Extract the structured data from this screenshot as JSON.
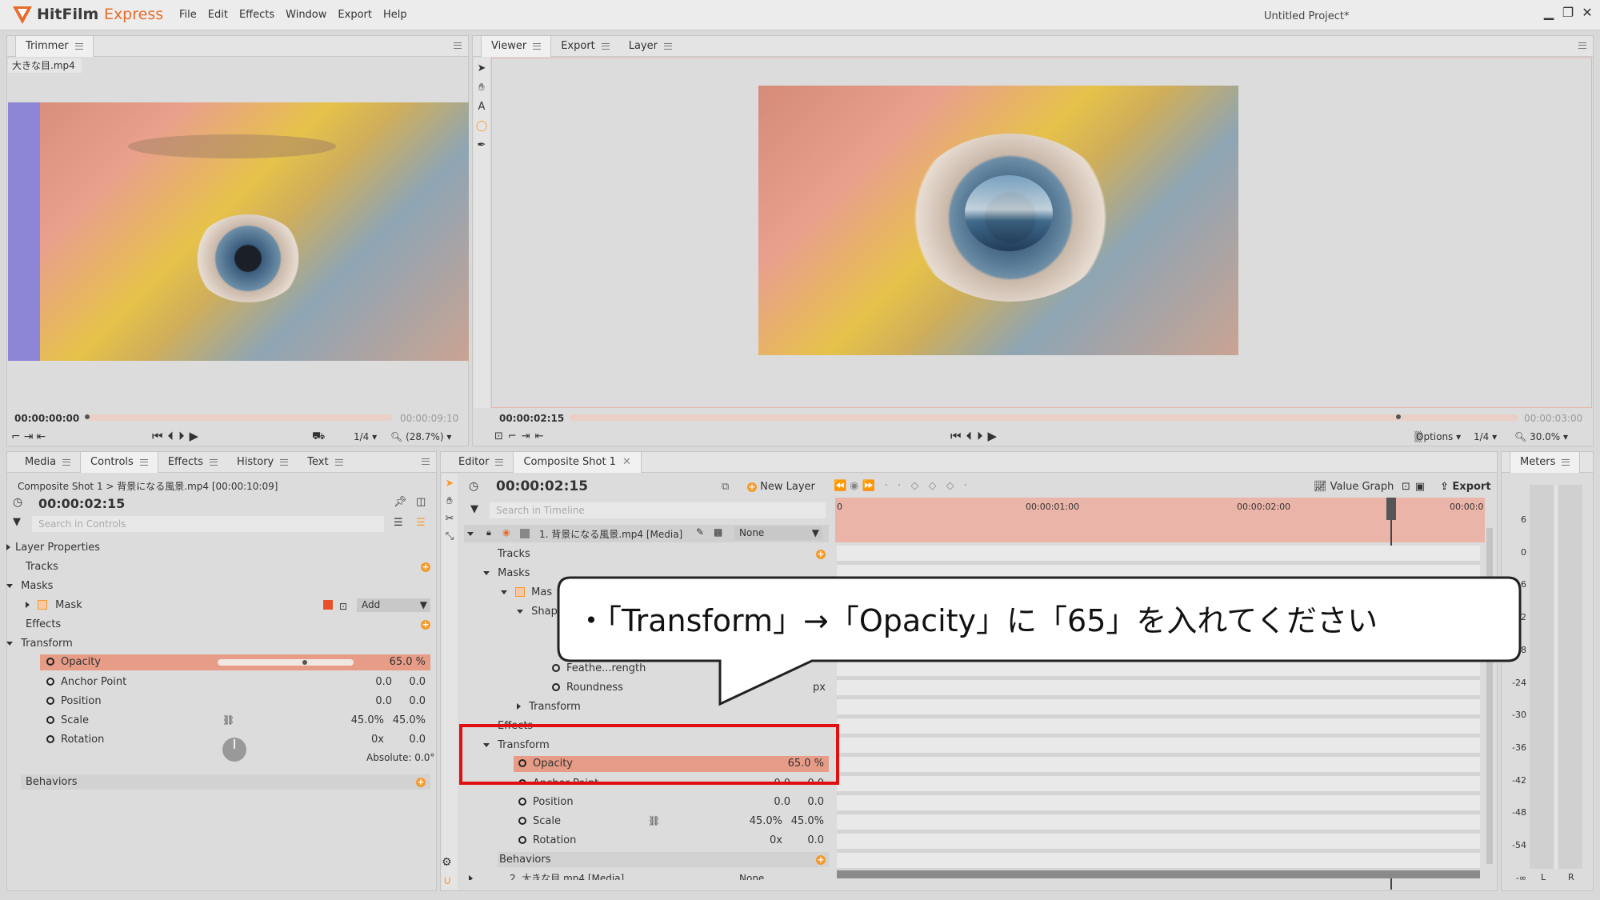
{
  "app": {
    "name_main": "HitFilm",
    "name_accent": "Express",
    "project_title": "Untitled Project*"
  },
  "menu": [
    "File",
    "Edit",
    "Effects",
    "Window",
    "Export",
    "Help"
  ],
  "trimmer": {
    "tab": "Trimmer",
    "file": "大きな目.mp4",
    "time_current": "00:00:00:00",
    "time_end": "00:00:09:10",
    "zoom_fraction": "1/4",
    "zoom_percent": "(28.7%)"
  },
  "viewer": {
    "tabs": [
      "Viewer",
      "Export",
      "Layer"
    ],
    "time_current": "00:00:02:15",
    "time_end": "00:00:03:00",
    "options": "Options",
    "zoom_fraction": "1/4",
    "zoom_percent": "30.0%"
  },
  "left_tabs": [
    "Media",
    "Controls",
    "Effects",
    "History",
    "Text"
  ],
  "controls": {
    "breadcrumb": "Composite Shot 1 > 背景になる風景.mp4 [00:00:10:09]",
    "time": "00:00:02:15",
    "search_placeholder": "Search in Controls",
    "rows": {
      "layer_properties": "Layer Properties",
      "tracks": "Tracks",
      "masks": "Masks",
      "mask": "Mask",
      "mask_mode": "Add",
      "effects": "Effects",
      "transform": "Transform",
      "opacity": "Opacity",
      "opacity_value": "65.0 %",
      "anchor": "Anchor Point",
      "anchor_x": "0.0",
      "anchor_y": "0.0",
      "position": "Position",
      "position_x": "0.0",
      "position_y": "0.0",
      "scale": "Scale",
      "scale_x": "45.0%",
      "scale_y": "45.0%",
      "rotation": "Rotation",
      "rotation_turns": "0x",
      "rotation_deg": "0.0",
      "absolute": "Absolute: 0.0°",
      "behaviors": "Behaviors"
    }
  },
  "editor": {
    "tabs": [
      "Editor",
      "Composite Shot 1"
    ],
    "time": "00:00:02:15",
    "new_layer": "New Layer",
    "value_graph": "Value Graph",
    "export": "Export",
    "search_placeholder": "Search in Timeline",
    "ruler": [
      "0",
      "00:00:01:00",
      "00:00:02:00",
      "00:00:0"
    ],
    "layer1": "1. 背景になる風景.mp4 [Media]",
    "blend": "None",
    "rows": {
      "tracks": "Tracks",
      "masks": "Masks",
      "mask": "Mas",
      "shape": "Shap",
      "feather": "Feathe...rength",
      "roundness": "Roundness",
      "roundness_unit": "px",
      "mask_transform": "Transform",
      "effects": "Effects",
      "transform": "Transform",
      "opacity": "Opacity",
      "opacity_value": "65.0 %",
      "anchor": "Anchor Point",
      "anchor_x": "0.0",
      "anchor_y": "0.0",
      "position": "Position",
      "position_x": "0.0",
      "position_y": "0.0",
      "scale": "Scale",
      "scale_x": "45.0%",
      "scale_y": "45.0%",
      "rotation": "Rotation",
      "rotation_turns": "0x",
      "rotation_deg": "0.0",
      "behaviors": "Behaviors",
      "layer2": "2. 大きな目.mp4 [Media]",
      "layer2_blend": "None"
    }
  },
  "meters": {
    "tab": "Meters",
    "scale": [
      "6",
      "0",
      "-6",
      "-12",
      "-18",
      "-24",
      "-30",
      "-36",
      "-42",
      "-48",
      "-54",
      "-∞"
    ],
    "channels": [
      "L",
      "R"
    ]
  },
  "callout": "・「Transform」→「Opacity」に「65」を入れてください",
  "colors": {
    "accent": "#f59a2c",
    "highlight": "#e79c87",
    "redbox": "#e01010"
  }
}
